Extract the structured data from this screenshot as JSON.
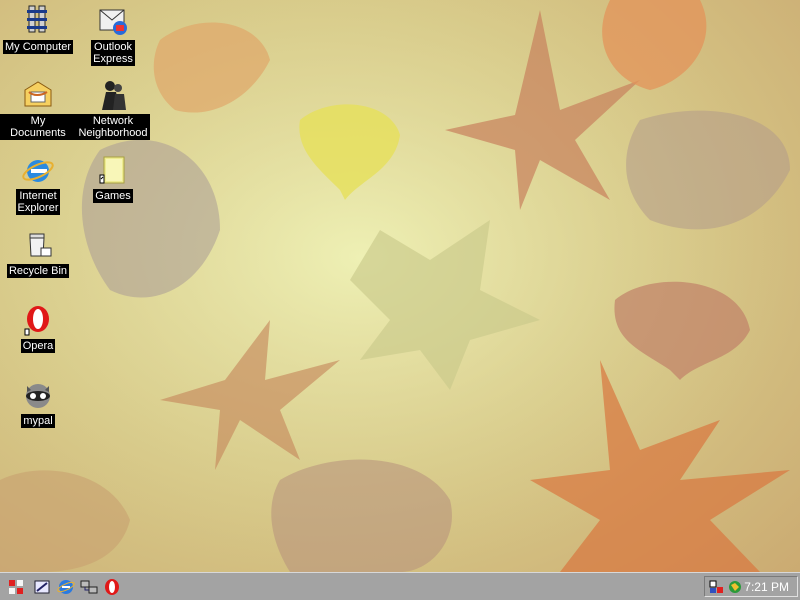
{
  "desktop": {
    "icons": [
      {
        "label": "My Computer",
        "icon": "my-computer-icon"
      },
      {
        "label": "Outlook\nExpress",
        "icon": "outlook-express-icon"
      },
      {
        "label": "My Documents",
        "icon": "my-documents-icon"
      },
      {
        "label": "Network\nNeighborhood",
        "icon": "network-neighborhood-icon"
      },
      {
        "label": "Internet\nExplorer",
        "icon": "internet-explorer-icon"
      },
      {
        "label": "Games",
        "icon": "games-folder-icon"
      },
      {
        "label": "Recycle Bin",
        "icon": "recycle-bin-icon"
      },
      {
        "label": "Opera",
        "icon": "opera-icon"
      },
      {
        "label": "mypal",
        "icon": "mypal-icon"
      }
    ],
    "wallpaper": "autumn-leaves-wallpaper"
  },
  "taskbar": {
    "start_icon": "start-menu-icon",
    "quick_launch": [
      "show-desktop-icon",
      "internet-explorer-icon",
      "network-icon",
      "opera-icon"
    ],
    "tray_icons": [
      "volume-icon",
      "globe-icon"
    ],
    "clock": "7:21 PM"
  },
  "colors": {
    "taskbar": "#a3a3a3",
    "label_background": "#000000",
    "label_text": "#ffffff",
    "wallpaper_base": "#e0dc9c"
  }
}
